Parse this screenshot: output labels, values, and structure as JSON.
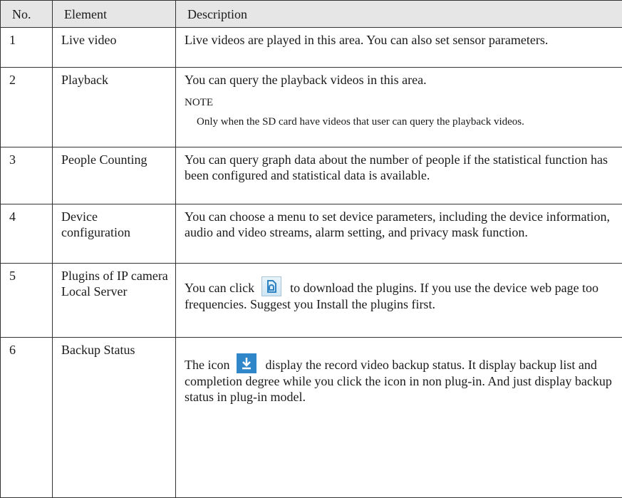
{
  "header": {
    "no": "No.",
    "element": "Element",
    "description": "Description"
  },
  "rows": [
    {
      "no": "1",
      "element": "Live video",
      "description": "Live videos are played in this area. You can also set sensor parameters."
    },
    {
      "no": "2",
      "element": "Playback",
      "description": "You can query the playback videos in this area.",
      "note_title": "NOTE",
      "note_body": "Only when the SD card have videos that user can query the playback videos."
    },
    {
      "no": "3",
      "element": "People Counting",
      "description": "You can query graph data about the number of people if the statistical function has been configured and statistical data is available."
    },
    {
      "no": "4",
      "element": "Device configuration",
      "description": "You can choose a menu to set device parameters, including the device information, audio and video streams, alarm setting, and privacy mask function."
    },
    {
      "no": "5",
      "element_line1": "Plugins of IP camera",
      "element_line2": "Local Server",
      "desc_before": "You can click",
      "desc_after": "to download the plugins. If you use the device web page too frequencies. Suggest you Install the plugins first.",
      "icon": "plugin-install-icon"
    },
    {
      "no": "6",
      "element": "Backup Status",
      "desc_before": "The icon",
      "desc_after": "display the record video backup status. It display backup list and completion degree while you click the icon in non plug-in. And just display backup status in plug-in model.",
      "icon": "download-backup-icon"
    }
  ]
}
